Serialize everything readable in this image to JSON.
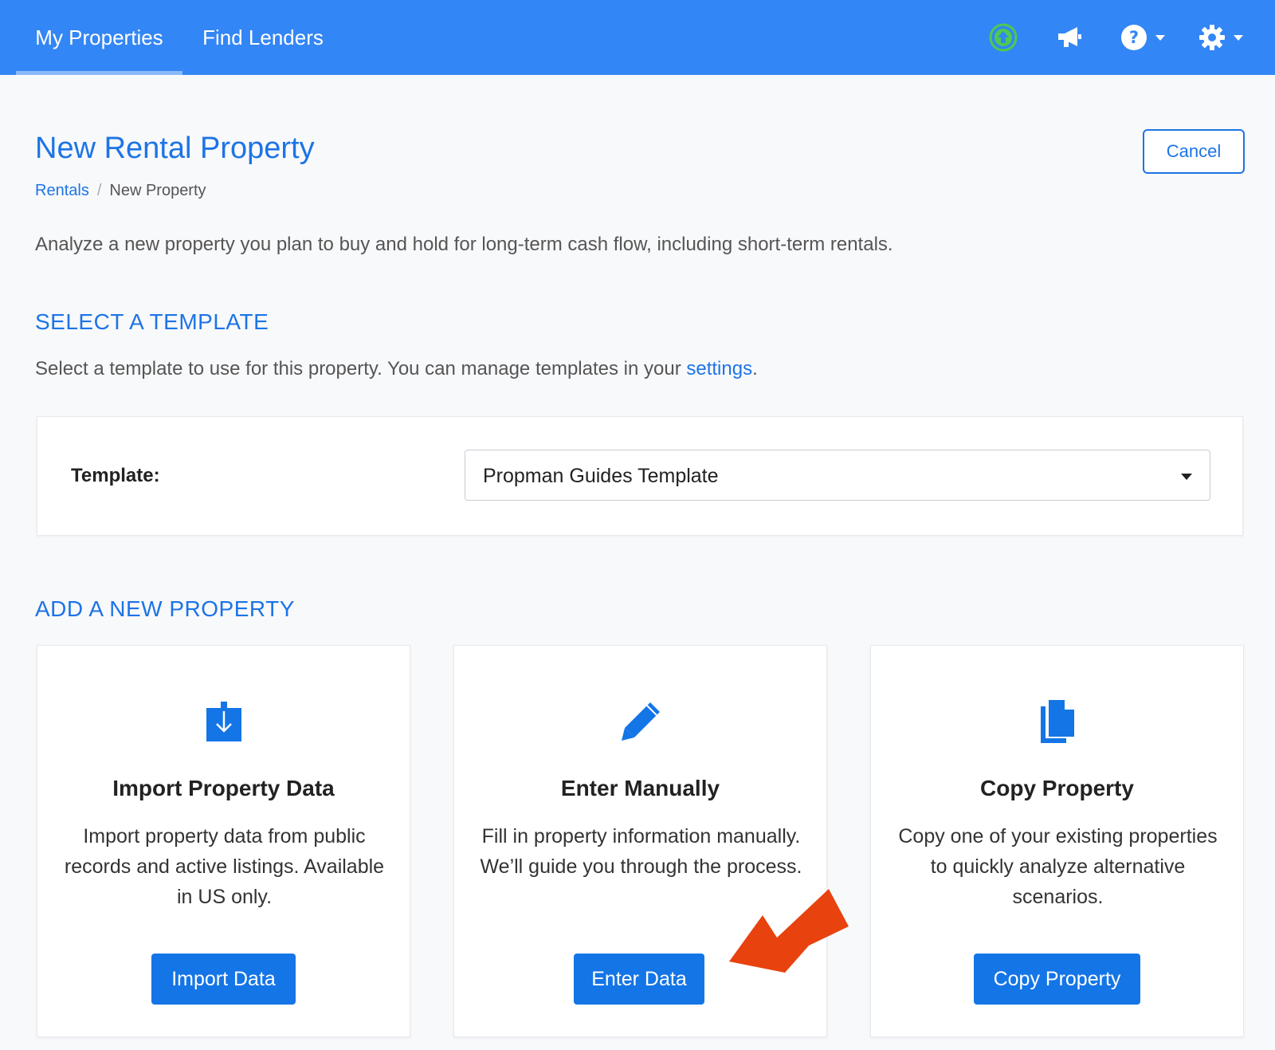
{
  "nav": {
    "tabs": [
      {
        "label": "My Properties",
        "active": true
      },
      {
        "label": "Find Lenders",
        "active": false
      }
    ],
    "icons": [
      "upgrade-arrow-circle-icon",
      "megaphone-icon",
      "help-circle-icon",
      "gear-icon"
    ]
  },
  "header": {
    "title": "New Rental Property",
    "cancel_label": "Cancel",
    "breadcrumb": {
      "link": "Rentals",
      "separator": "/",
      "current": "New Property"
    }
  },
  "intro": "Analyze a new property you plan to buy and hold for long-term cash flow, including short-term rentals.",
  "template_section": {
    "heading": "SELECT A TEMPLATE",
    "desc_prefix": "Select a template to use for this property. You can manage templates in your ",
    "desc_link": "settings",
    "desc_suffix": ".",
    "label": "Template:",
    "selected": "Propman Guides Template"
  },
  "add_section": {
    "heading": "ADD A NEW PROPERTY",
    "cards": [
      {
        "icon": "download-box-icon",
        "title": "Import Property Data",
        "description": "Import property data from public records and active listings. Available in US only.",
        "button": "Import Data"
      },
      {
        "icon": "pencil-icon",
        "title": "Enter Manually",
        "description": "Fill in property information manually. We’ll guide you through the process.",
        "button": "Enter Data"
      },
      {
        "icon": "document-copy-icon",
        "title": "Copy Property",
        "description": "Copy one of your existing properties to quickly analyze alternative scenarios.",
        "button": "Copy Property"
      }
    ]
  },
  "colors": {
    "nav_bg": "#3386f5",
    "primary": "#1475e6",
    "link": "#1d74e6",
    "upgrade_green": "#4fc94f",
    "annotation_arrow": "#e8420f"
  }
}
